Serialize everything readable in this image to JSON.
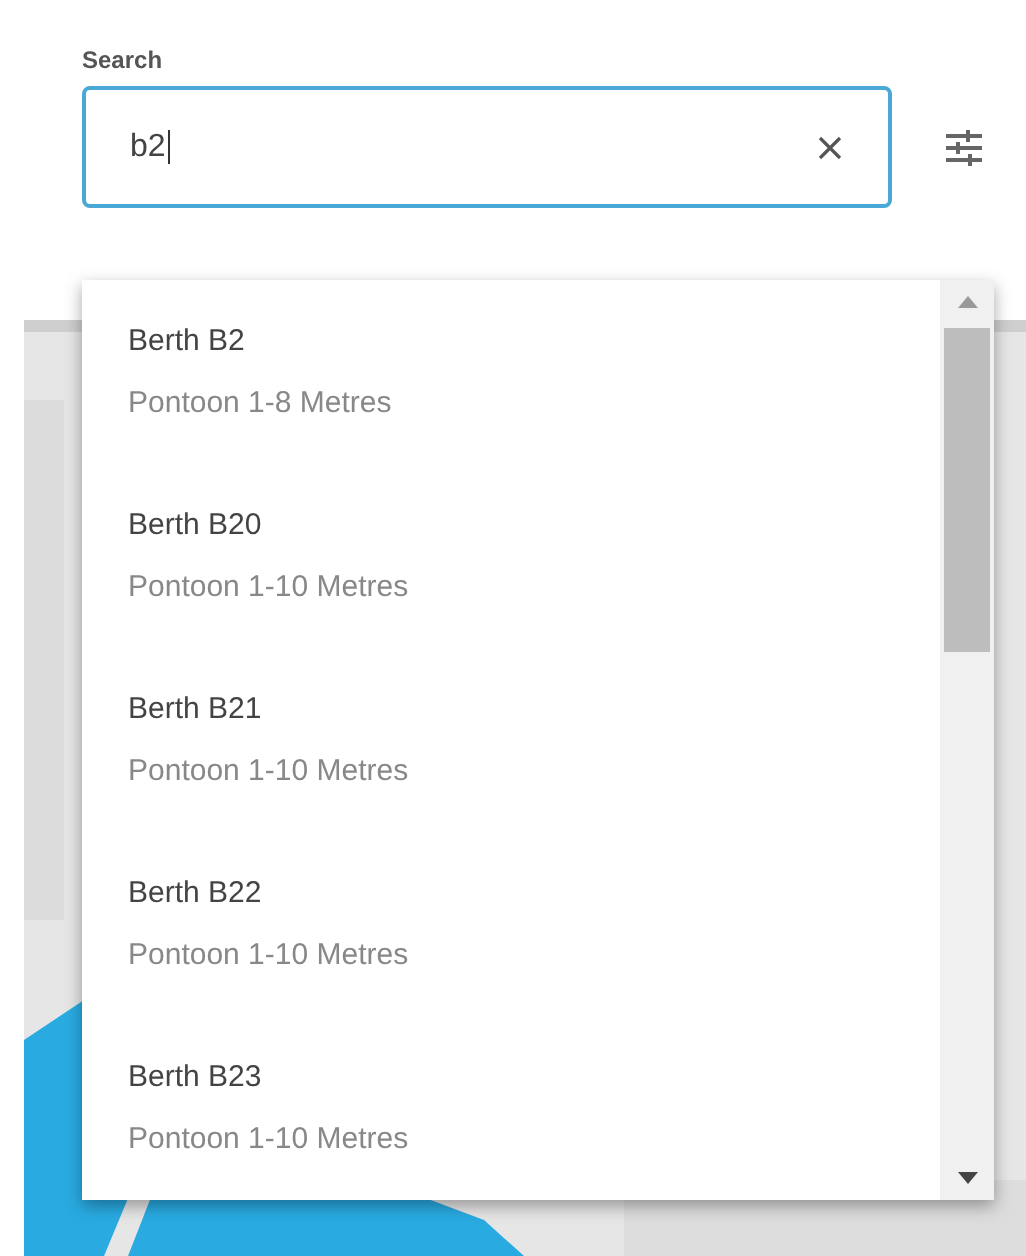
{
  "search": {
    "label": "Search",
    "value": "b2"
  },
  "results": [
    {
      "title": "Berth B2",
      "subtitle": "Pontoon 1-8 Metres"
    },
    {
      "title": "Berth B20",
      "subtitle": "Pontoon 1-10 Metres"
    },
    {
      "title": "Berth B21",
      "subtitle": "Pontoon 1-10 Metres"
    },
    {
      "title": "Berth B22",
      "subtitle": "Pontoon 1-10 Metres"
    },
    {
      "title": "Berth B23",
      "subtitle": "Pontoon 1-10 Metres"
    }
  ]
}
